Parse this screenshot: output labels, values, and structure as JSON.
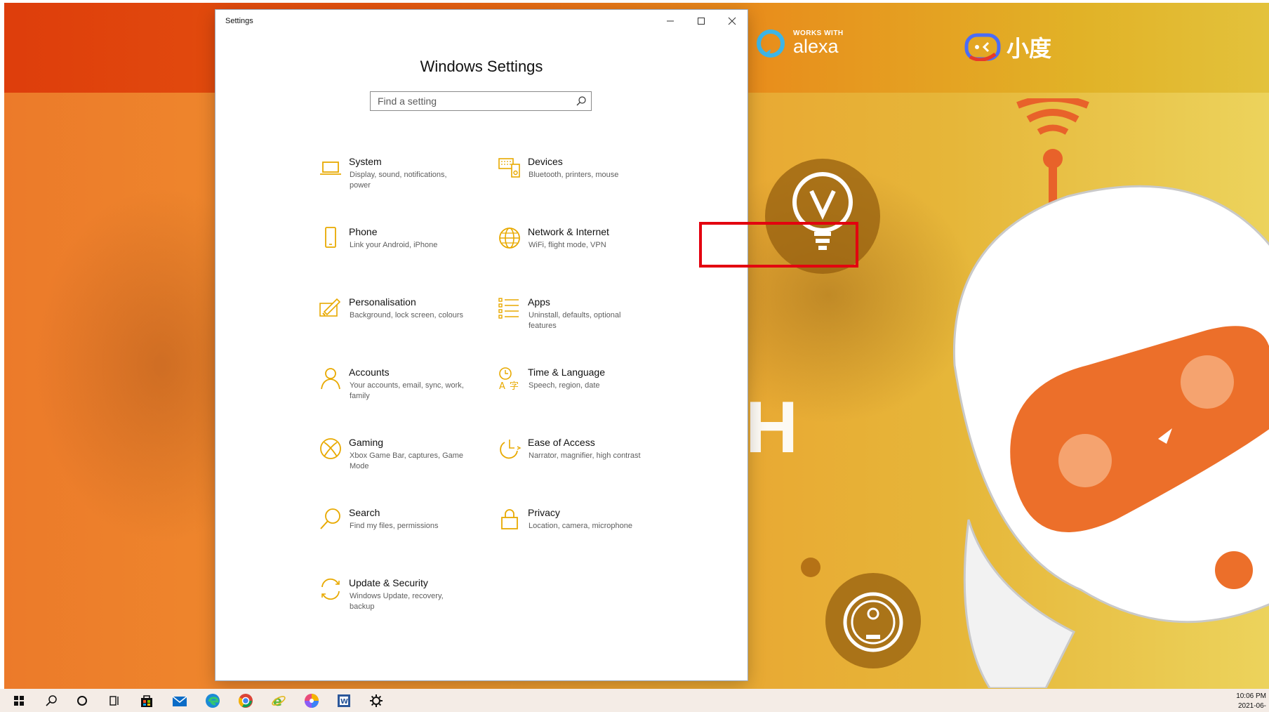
{
  "desktop": {
    "alexa_small": "WORKS WITH",
    "alexa_big": "alexa",
    "xiaodu_label": "小度",
    "big_letter": "H"
  },
  "window": {
    "title": "Settings",
    "minimize_glyph": "—",
    "maximize_glyph": "☐",
    "close_glyph": "✕"
  },
  "settings": {
    "heading": "Windows Settings",
    "search_placeholder": "Find a setting",
    "items": [
      {
        "title": "System",
        "desc": "Display, sound, notifications, power",
        "icon": "laptop-icon"
      },
      {
        "title": "Devices",
        "desc": "Bluetooth, printers, mouse",
        "icon": "keyboard-speaker-icon"
      },
      {
        "title": "Phone",
        "desc": "Link your Android, iPhone",
        "icon": "phone-icon"
      },
      {
        "title": "Network & Internet",
        "desc": "WiFi, flight mode, VPN",
        "icon": "globe-icon"
      },
      {
        "title": "Personalisation",
        "desc": "Background, lock screen, colours",
        "icon": "paintbrush-icon"
      },
      {
        "title": "Apps",
        "desc": "Uninstall, defaults, optional features",
        "icon": "apps-list-icon"
      },
      {
        "title": "Accounts",
        "desc": "Your accounts, email, sync, work, family",
        "icon": "person-icon"
      },
      {
        "title": "Time & Language",
        "desc": "Speech, region, date",
        "icon": "time-language-icon"
      },
      {
        "title": "Gaming",
        "desc": "Xbox Game Bar, captures, Game Mode",
        "icon": "xbox-icon"
      },
      {
        "title": "Ease of Access",
        "desc": "Narrator, magnifier, high contrast",
        "icon": "ease-of-access-icon"
      },
      {
        "title": "Search",
        "desc": "Find my files, permissions",
        "icon": "search-icon"
      },
      {
        "title": "Privacy",
        "desc": "Location, camera, microphone",
        "icon": "lock-icon"
      },
      {
        "title": "Update & Security",
        "desc": "Windows Update, recovery, backup",
        "icon": "sync-icon"
      }
    ]
  },
  "taskbar": {
    "icons": [
      "windows-start-icon",
      "search-icon",
      "cortana-icon",
      "task-view-icon",
      "store-icon",
      "mail-icon",
      "edge-icon",
      "chrome-icon",
      "ie-icon",
      "color-app-icon",
      "word-icon",
      "settings-gear-icon"
    ],
    "time": "10:06 PM",
    "date": "2021-06-"
  },
  "colors": {
    "accent_icon": "#e8a900",
    "highlight": "#e3000f"
  }
}
